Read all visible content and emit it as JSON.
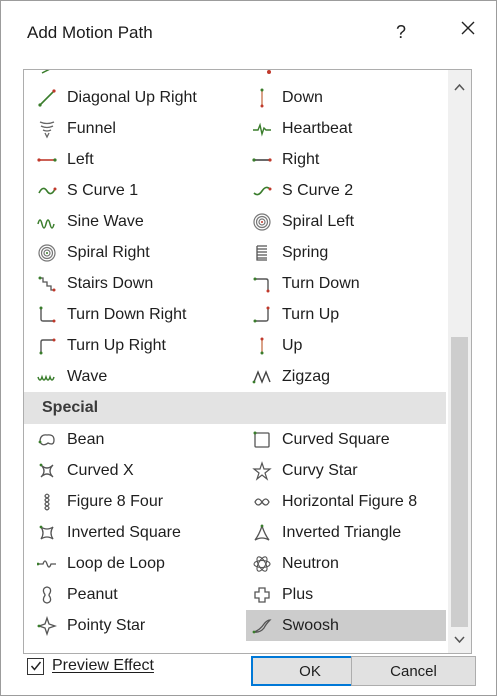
{
  "window": {
    "title": "Add Motion Path",
    "help_label": "?",
    "close_icon": "close-icon"
  },
  "list": {
    "rows": [
      {
        "left": {
          "label": "Diagonal Up Right",
          "icon": "diagonal-up-right-icon"
        },
        "right": {
          "label": "Down",
          "icon": "down-icon"
        }
      },
      {
        "left": {
          "label": "Funnel",
          "icon": "funnel-icon"
        },
        "right": {
          "label": "Heartbeat",
          "icon": "heartbeat-icon"
        }
      },
      {
        "left": {
          "label": "Left",
          "icon": "left-icon"
        },
        "right": {
          "label": "Right",
          "icon": "right-icon"
        }
      },
      {
        "left": {
          "label": "S Curve 1",
          "icon": "s-curve-1-icon"
        },
        "right": {
          "label": "S Curve 2",
          "icon": "s-curve-2-icon"
        }
      },
      {
        "left": {
          "label": "Sine Wave",
          "icon": "sine-wave-icon"
        },
        "right": {
          "label": "Spiral Left",
          "icon": "spiral-left-icon"
        }
      },
      {
        "left": {
          "label": "Spiral Right",
          "icon": "spiral-right-icon"
        },
        "right": {
          "label": "Spring",
          "icon": "spring-icon"
        }
      },
      {
        "left": {
          "label": "Stairs Down",
          "icon": "stairs-down-icon"
        },
        "right": {
          "label": "Turn Down",
          "icon": "turn-down-icon"
        }
      },
      {
        "left": {
          "label": "Turn Down Right",
          "icon": "turn-down-right-icon"
        },
        "right": {
          "label": "Turn Up",
          "icon": "turn-up-icon"
        }
      },
      {
        "left": {
          "label": "Turn Up Right",
          "icon": "turn-up-right-icon"
        },
        "right": {
          "label": "Up",
          "icon": "up-icon"
        }
      },
      {
        "left": {
          "label": "Wave",
          "icon": "wave-icon"
        },
        "right": {
          "label": "Zigzag",
          "icon": "zigzag-icon"
        }
      }
    ],
    "special_header": "Special",
    "special_rows": [
      {
        "left": {
          "label": "Bean",
          "icon": "bean-icon"
        },
        "right": {
          "label": "Curved Square",
          "icon": "curved-square-icon"
        }
      },
      {
        "left": {
          "label": "Curved X",
          "icon": "curved-x-icon"
        },
        "right": {
          "label": "Curvy Star",
          "icon": "curvy-star-icon"
        }
      },
      {
        "left": {
          "label": "Figure 8 Four",
          "icon": "figure-8-four-icon"
        },
        "right": {
          "label": "Horizontal Figure 8",
          "icon": "horizontal-figure-8-icon"
        }
      },
      {
        "left": {
          "label": "Inverted Square",
          "icon": "inverted-square-icon"
        },
        "right": {
          "label": "Inverted Triangle",
          "icon": "inverted-triangle-icon"
        }
      },
      {
        "left": {
          "label": "Loop de Loop",
          "icon": "loop-de-loop-icon"
        },
        "right": {
          "label": "Neutron",
          "icon": "neutron-icon"
        }
      },
      {
        "left": {
          "label": "Peanut",
          "icon": "peanut-icon"
        },
        "right": {
          "label": "Plus",
          "icon": "plus-icon"
        }
      },
      {
        "left": {
          "label": "Pointy Star",
          "icon": "pointy-star-icon"
        },
        "right": {
          "label": "Swoosh",
          "icon": "swoosh-icon",
          "selected": true
        }
      }
    ],
    "scroll_up_icon": "chevron-up-icon",
    "scroll_down_icon": "chevron-down-icon"
  },
  "footer": {
    "preview_label": "Preview Effect",
    "preview_checked": true,
    "ok_label": "OK",
    "cancel_label": "Cancel"
  },
  "colors": {
    "path_green": "#3a7d2c",
    "path_red": "#c0392b",
    "selection": "#cccccc",
    "accent": "#0078d7"
  }
}
